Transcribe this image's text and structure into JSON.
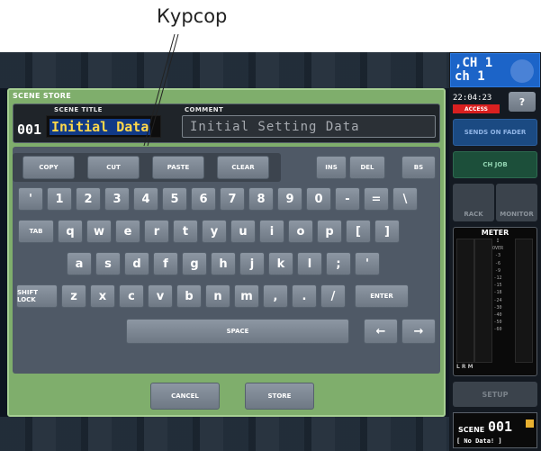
{
  "annotation": {
    "cursor_label": "Курсор"
  },
  "dialog": {
    "title": "SCENE STORE",
    "scene_title_label": "SCENE TITLE",
    "comment_label": "COMMENT",
    "scene_number": "001",
    "title_value": "Initial Data",
    "comment_value": "Initial Setting Data",
    "cancel_label": "CANCEL",
    "store_label": "STORE"
  },
  "keyboard": {
    "function_keys": [
      "COPY",
      "CUT",
      "PASTE",
      "CLEAR"
    ],
    "edit_keys": [
      "INS",
      "DEL",
      "BS"
    ],
    "row1": [
      "'",
      "1",
      "2",
      "3",
      "4",
      "5",
      "6",
      "7",
      "8",
      "9",
      "0",
      "-",
      "=",
      "\\"
    ],
    "tab": "TAB",
    "row2": [
      "q",
      "w",
      "e",
      "r",
      "t",
      "y",
      "u",
      "i",
      "o",
      "p",
      "[",
      "]"
    ],
    "row3": [
      "a",
      "s",
      "d",
      "f",
      "g",
      "h",
      "j",
      "k",
      "l",
      ";",
      "'"
    ],
    "shift_lock": "SHIFT LOCK",
    "row4": [
      "z",
      "x",
      "c",
      "v",
      "b",
      "n",
      "m",
      ",",
      ".",
      "/"
    ],
    "enter": "ENTER",
    "space": "SPACE",
    "left_arrow": "←",
    "right_arrow": "→"
  },
  "sidebar": {
    "channel_line1": ",CH 1",
    "channel_line2": "ch 1",
    "time": "22:04:23",
    "access": "ACCESS",
    "help": "?",
    "sends_on_fader": "SENDS ON FADER",
    "ch_job": "CH JOB",
    "rack": "RACK",
    "monitor": "MONITOR",
    "meter_title": "METER",
    "meter_scale": [
      "I",
      "OVER",
      "-3",
      "-6",
      "-9",
      "-12",
      "-15",
      "-18",
      "-24",
      "-30",
      "-40",
      "-50",
      "-60"
    ],
    "meter_channels": "L  R  M",
    "setup": "SETUP",
    "scene_label": "SCENE",
    "scene_number": "001",
    "scene_name": "[  No Data!  ]"
  }
}
